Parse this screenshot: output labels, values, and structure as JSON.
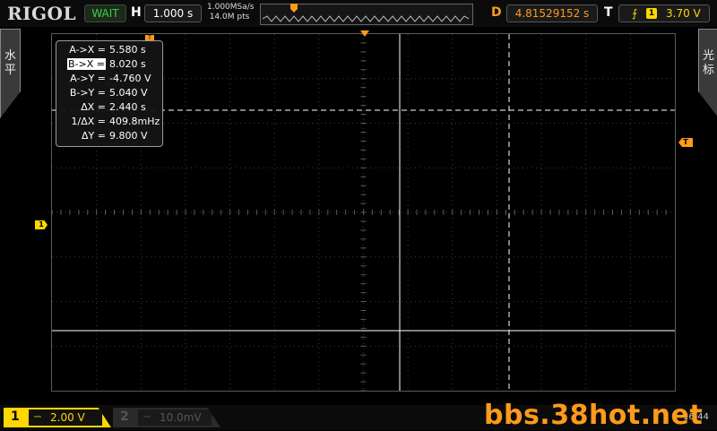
{
  "brand": "RIGOL",
  "status": {
    "run_state": "WAIT"
  },
  "horizontal": {
    "label": "H",
    "timebase": "1.000 s"
  },
  "acquisition": {
    "sample_rate": "1.000MSa/s",
    "memory_depth": "14.0M pts"
  },
  "delay": {
    "label": "D",
    "value": "4.81529152 s"
  },
  "trigger": {
    "label": "T",
    "edge_icon": "rising-edge-icon",
    "source": "1",
    "level": "3.70 V"
  },
  "side_tabs": {
    "left": "水平",
    "right": "光标"
  },
  "cursor_measurements": {
    "rows": [
      {
        "key": "A->X =",
        "value": "5.580 s"
      },
      {
        "key": "B->X =",
        "value": "8.020 s"
      },
      {
        "key": "A->Y =",
        "value": "-4.760 V"
      },
      {
        "key": "B->Y =",
        "value": "5.040 V"
      },
      {
        "key": "ΔX =",
        "value": "2.440 s"
      },
      {
        "key": "1/ΔX =",
        "value": "409.8mHz"
      },
      {
        "key": "ΔY =",
        "value": "9.800 V"
      }
    ]
  },
  "markers": {
    "ch1": "1",
    "trigger_level": "T",
    "small": "T"
  },
  "channels": [
    {
      "number": "1",
      "coupling": "⎓",
      "scale": "2.00 V",
      "active": true
    },
    {
      "number": "2",
      "coupling": "⎓",
      "scale": "10.0mV",
      "active": false
    }
  ],
  "clock": "16:44",
  "watermark": "bbs.38hot.net",
  "colors": {
    "ch1": "#ffd700",
    "trigger": "#ff9a1a",
    "run_state": "#37d24a",
    "cursor": "#ffffff"
  }
}
